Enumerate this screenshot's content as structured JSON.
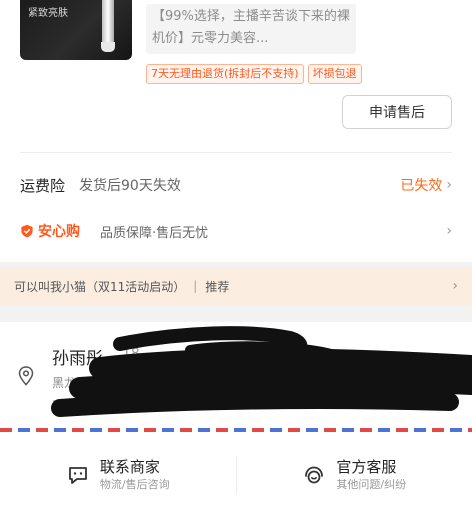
{
  "product": {
    "thumbnail_caption": "紧致亮肤",
    "title": "【99%选择，主播辛苦谈下来的裸机价】元零力美容...",
    "tags": [
      "7天无理由退货(拆封后不支持)",
      "坏损包退"
    ],
    "after_sale_button": "申请售后"
  },
  "freight_insurance": {
    "label": "运费险",
    "desc": "发货后90天失效",
    "status": "已失效",
    "status_color": "#ff6a14"
  },
  "secure_purchase": {
    "name": "安心购",
    "desc": "品质保障·售后无忧"
  },
  "banner": {
    "text": "可以叫我小猫（双11活动启动）",
    "separator": "|",
    "action": "推荐"
  },
  "address": {
    "name": "孙雨彤",
    "phone": "18",
    "detail": "黑龙江省哈尔滨市南岗区",
    "detail_line2": "..."
  },
  "contacts": [
    {
      "title": "联系商家",
      "sub": "物流/售后咨询",
      "icon": "merchant-chat-icon"
    },
    {
      "title": "官方客服",
      "sub": "其他问题/纠纷",
      "icon": "customer-service-icon"
    }
  ],
  "colors": {
    "accent": "#ff5a1e",
    "banner_bg": "#fbeee1"
  }
}
